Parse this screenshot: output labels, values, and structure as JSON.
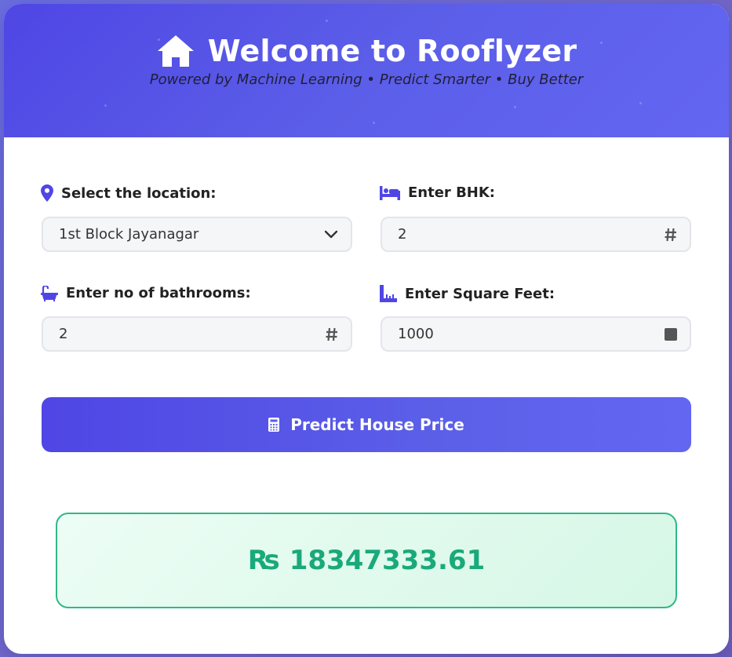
{
  "header": {
    "title": "Welcome to Rooflyzer",
    "subtitle": "Powered by Machine Learning • Predict Smarter • Buy Better",
    "icon": "home-icon"
  },
  "form": {
    "location": {
      "label": "Select the location:",
      "value": "1st Block Jayanagar",
      "icon": "map-pin-icon"
    },
    "bhk": {
      "label": "Enter BHK:",
      "value": "2",
      "icon": "bed-icon"
    },
    "bathrooms": {
      "label": "Enter no of bathrooms:",
      "value": "2",
      "icon": "bath-icon"
    },
    "sqft": {
      "label": "Enter Square Feet:",
      "value": "1000",
      "icon": "ruler-icon"
    }
  },
  "predict_button": {
    "label": "Predict House Price",
    "icon": "calculator-icon"
  },
  "result": {
    "currency": "₨",
    "value": "18347333.61"
  },
  "colors": {
    "accent": "#4f46e5",
    "result_text": "#1aa97a",
    "result_border": "#2fb889"
  }
}
